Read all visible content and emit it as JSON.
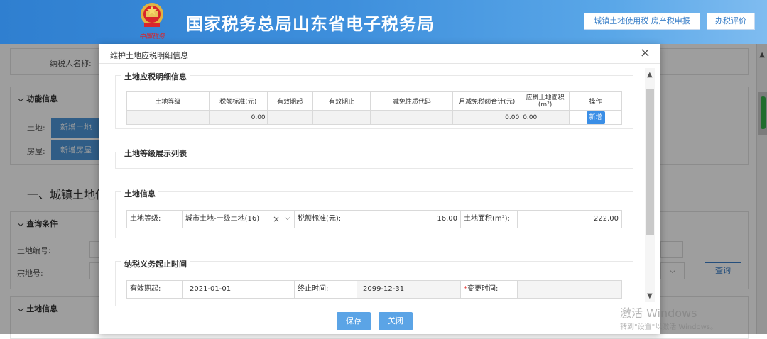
{
  "header": {
    "title": "国家税务总局山东省电子税务局",
    "emblem_caption": "中国税务",
    "buttons": [
      "城镇土地使用税 房产税申报",
      "办税评价"
    ]
  },
  "background": {
    "taxpayer_label": "纳税人名称:",
    "function_section": "功能信息",
    "land_label": "土地:",
    "land_button": "新增土地",
    "house_label": "房屋:",
    "house_button": "新增房屋",
    "section_heading": "一、城镇土地使",
    "query_section": "查询条件",
    "land_no_label": "土地编号:",
    "parcel_no_label": "宗地号:",
    "query_button": "查询",
    "land_info_section": "土地信息"
  },
  "modal": {
    "title": "维护土地应税明细信息",
    "close_icon": "×",
    "detail_section": "土地应税明细信息",
    "detail_table": {
      "headers": [
        "土地等级",
        "税额标准(元)",
        "有效期起",
        "有效期止",
        "减免性质代码",
        "月减免税额合计(元)",
        "应税土地面积\n(m²)",
        "操作"
      ],
      "row": [
        "",
        "0.00",
        "",
        "",
        "",
        "0.00",
        "0.00"
      ],
      "add_button": "新增"
    },
    "grade_list_section": "土地等级展示列表",
    "land_info_section": "土地信息",
    "land_info": {
      "grade_label": "土地等级:",
      "grade_value": "城市土地-一级土地(16)",
      "clear_icon": "×",
      "dropdown_icon": "⌵",
      "tax_std_label": "税额标准(元):",
      "tax_std_value": "16.00",
      "area_label": "土地面积(m²):",
      "area_value": "222.00"
    },
    "period_section": "纳税义务起止时间",
    "period": {
      "start_label": "有效期起:",
      "start_value": "2021-01-01",
      "end_label": "终止时间:",
      "end_value": "2099-12-31",
      "required_mark": "*",
      "change_label": "变更时间:",
      "change_value": ""
    },
    "save_button": "保存",
    "close_button": "关闭"
  },
  "watermark": {
    "line1": "激活 Windows",
    "line2": "转到\"设置\"以激活 Windows。"
  },
  "colors": {
    "header_blue": "#3e8fdc",
    "button_blue": "#4e97d8",
    "accent_red": "#d8262b"
  }
}
